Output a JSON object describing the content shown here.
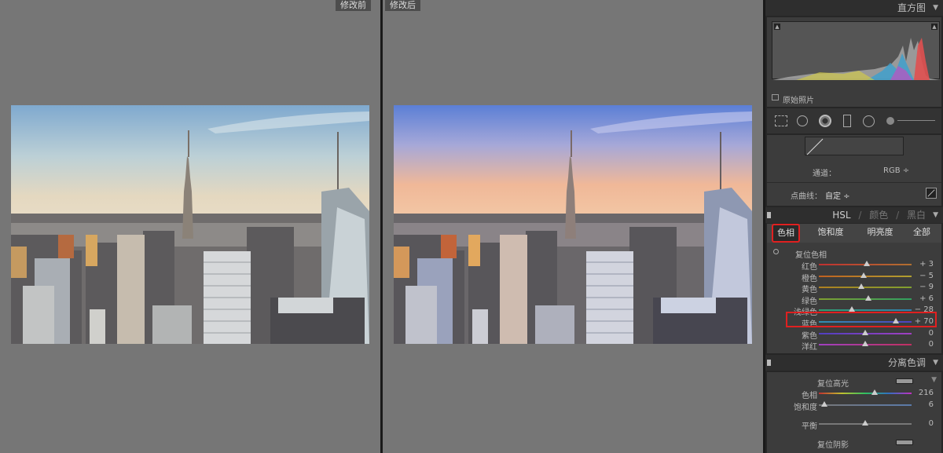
{
  "before_label": "修改前",
  "after_label": "修改后",
  "panel": {
    "histogram_title": "直方图",
    "original_photo": "原始照片",
    "channel_label": "通道：",
    "channel_value": "RGB ÷",
    "curve_label": "点曲线：",
    "curve_value": "自定 ÷",
    "hsl_header": {
      "hsl": "HSL",
      "sep1": "/",
      "color": "颜色",
      "sep2": "/",
      "bw": "黑白"
    },
    "tabs": [
      "色相",
      "饱和度",
      "明亮度",
      "全部"
    ],
    "reset_hue": "复位色相",
    "sliders": [
      {
        "label": "红色",
        "value": "+ 3",
        "pos": 0.52,
        "grad": "#c03030,#b07030"
      },
      {
        "label": "橙色",
        "value": "− 5",
        "pos": 0.48,
        "grad": "#c06020,#b0a030"
      },
      {
        "label": "黄色",
        "value": "− 9",
        "pos": 0.46,
        "grad": "#b08020,#80a030"
      },
      {
        "label": "绿色",
        "value": "+ 6",
        "pos": 0.53,
        "grad": "#80a030,#30a060"
      },
      {
        "label": "浅绿色",
        "value": "− 28",
        "pos": 0.36,
        "grad": "#30a070,#3080b0"
      },
      {
        "label": "蓝色",
        "value": "+ 70",
        "pos": 0.83,
        "grad": "#3090b0,#5040c0"
      },
      {
        "label": "紫色",
        "value": "0",
        "pos": 0.5,
        "grad": "#5040c0,#a040c0"
      },
      {
        "label": "洋红",
        "value": "0",
        "pos": 0.5,
        "grad": "#a040c0,#c03060"
      }
    ],
    "split_header": "分离色调",
    "reset_highlight": "复位高光",
    "split_sliders": [
      {
        "label": "色相",
        "value": "216",
        "pos": 0.6,
        "grad": "#c03030,#c0c030,#30c060,#3070c0,#c030c0"
      },
      {
        "label": "饱和度",
        "value": "6",
        "pos": 0.06,
        "grad": "#777,#5a7aaa"
      }
    ],
    "balance_label": "平衡",
    "balance_value": "0",
    "balance_pos": 0.5,
    "reset_shadow": "复位阴影"
  }
}
